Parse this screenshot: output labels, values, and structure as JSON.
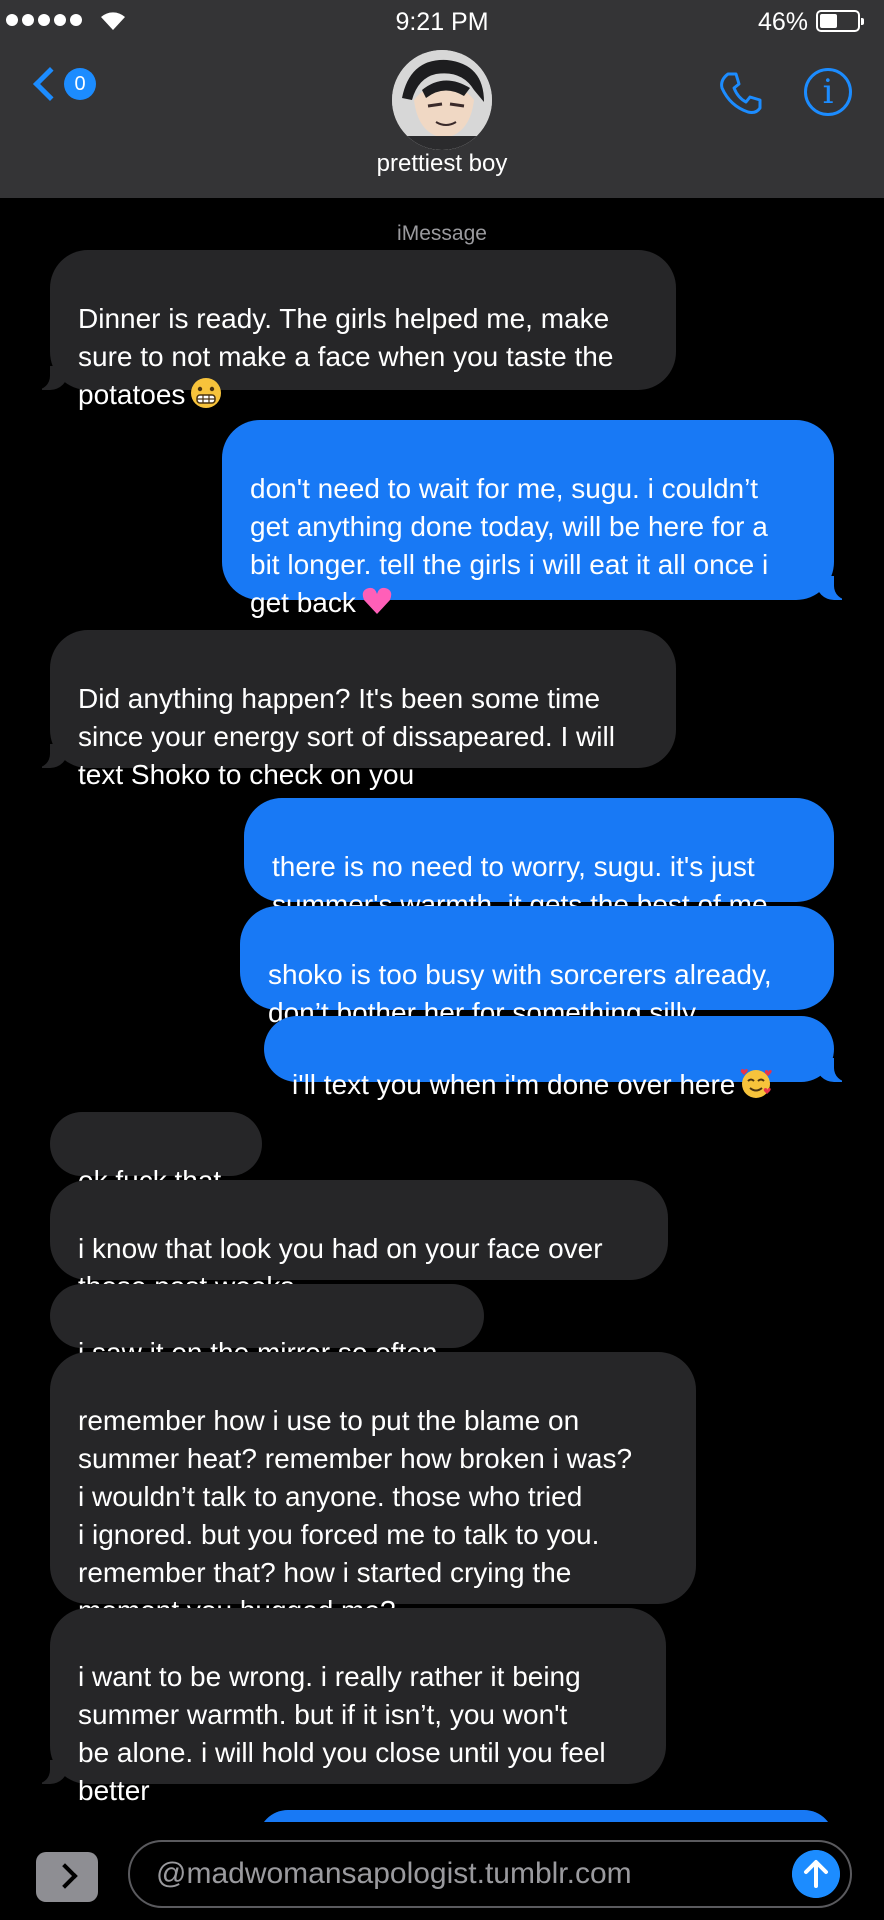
{
  "status_bar": {
    "time": "9:21 PM",
    "battery": "46%",
    "battery_level": 0.46
  },
  "header": {
    "back_badge": "0",
    "contact_name": "prettiest boy",
    "icons": [
      "back-chevron-icon",
      "phone-icon",
      "info-icon"
    ]
  },
  "conversation": {
    "service_label": "iMessage",
    "messages": [
      {
        "from": "them",
        "text": "Dinner is ready. The girls helped me, make\nsure to not make a face when you taste the\npotatoes",
        "emoji": "grimacing-face"
      },
      {
        "from": "me",
        "text": "don't need to wait for me, sugu. i couldn’t\nget anything done today, will be here for a\nbit longer. tell the girls i will eat it all once i\nget back",
        "emoji": "pink-heart"
      },
      {
        "from": "them",
        "text": "Did anything happen? It's been some time\nsince your energy sort of dissapeared. I will\ntext Shoko to check on you"
      },
      {
        "from": "me",
        "text": "there is no need to worry, sugu. it's just\nsummer's warmth. it gets the best of me"
      },
      {
        "from": "me",
        "text": "shoko is too busy with sorcerers already,\ndon’t bother her for something silly"
      },
      {
        "from": "me",
        "text": "i'll text you when i'm done over here",
        "emoji": "smiling-face-with-hearts"
      },
      {
        "from": "them",
        "text": "ok fuck that"
      },
      {
        "from": "them",
        "text": "i know that look you had on your face over\nthose past weeks"
      },
      {
        "from": "them",
        "text": "i saw it on the mirror so often"
      },
      {
        "from": "them",
        "text": "remember how i use to put the blame on\nsummer heat? remember how broken i was?\ni wouldn’t talk to anyone. those who tried\ni ignored. but you forced me to talk to you.\nremember that? how i started crying the\nmoment you hugged me?"
      },
      {
        "from": "them",
        "text": "i want to be wrong. i really rather it being\nsummer warmth. but if it isn’t, you won't\nbe alone. i will hold you close until you feel\nbetter"
      }
    ]
  },
  "compose": {
    "input_value": "@madwomansapologist.tumblr.com",
    "icons": [
      "apps-chevron-icon",
      "send-arrow-icon"
    ]
  },
  "colors": {
    "header_bg": "#343436",
    "incoming_bubble": "#262628",
    "outgoing_bubble": "#1879f5",
    "accent": "#1c8cff"
  }
}
